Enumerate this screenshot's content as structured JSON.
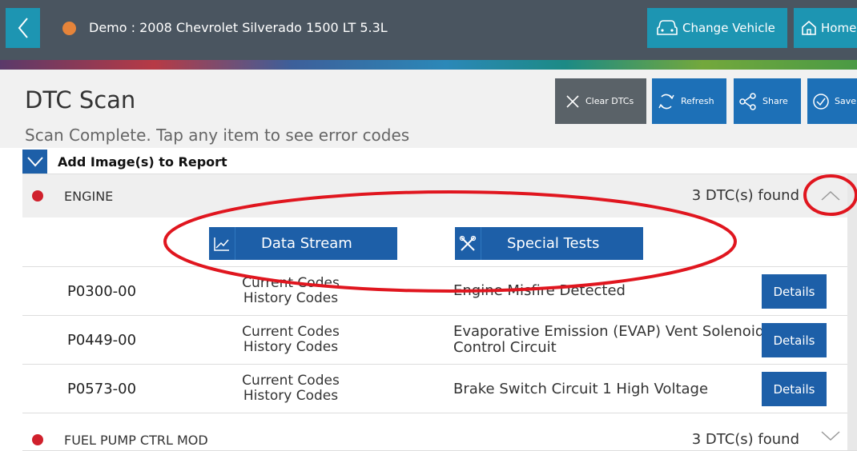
{
  "header": {
    "vehicle_title": "Demo : 2008 Chevrolet Silverado 1500 LT 5.3L",
    "change_vehicle_label": "Change Vehicle",
    "home_label": "Home"
  },
  "page": {
    "title": "DTC Scan",
    "subtitle": "Scan Complete. Tap any item to see error codes"
  },
  "actions": {
    "clear": "Clear DTCs",
    "refresh": "Refresh",
    "share": "Share",
    "save": "Save"
  },
  "add_image": {
    "label": "Add Image(s) to Report"
  },
  "modules": [
    {
      "name": "ENGINE",
      "count": "3 DTC(s) found"
    },
    {
      "name": "FUEL PUMP CTRL MOD",
      "count": "3 DTC(s) found"
    }
  ],
  "tools": {
    "data_stream": "Data Stream",
    "special_tests": "Special Tests"
  },
  "dtcs": [
    {
      "code": "P0300-00",
      "status1": "Current Codes",
      "status2": "History Codes",
      "desc": "Engine Misfire Detected",
      "details": "Details"
    },
    {
      "code": "P0449-00",
      "status1": "Current Codes",
      "status2": "History Codes",
      "desc": "Evaporative Emission (EVAP) Vent Solenoid Control Circuit",
      "details": "Details"
    },
    {
      "code": "P0573-00",
      "status1": "Current Codes",
      "status2": "History Codes",
      "desc": "Brake Switch Circuit 1 High Voltage",
      "details": "Details"
    }
  ],
  "colors": {
    "header_bg": "#4a5560",
    "accent_teal": "#1d95b2",
    "primary_blue": "#1d5fa8",
    "error_red": "#d0202c",
    "status_orange": "#e6843a",
    "annotation_red": "#e0161f"
  },
  "icons": {
    "back": "chevron-left-icon",
    "change_vehicle": "car-icon",
    "home": "home-icon",
    "clear": "close-icon",
    "refresh": "refresh-icon",
    "share": "share-icon",
    "save": "check-circle-icon",
    "data_stream": "chart-line-icon",
    "special_tests": "tools-icon"
  }
}
